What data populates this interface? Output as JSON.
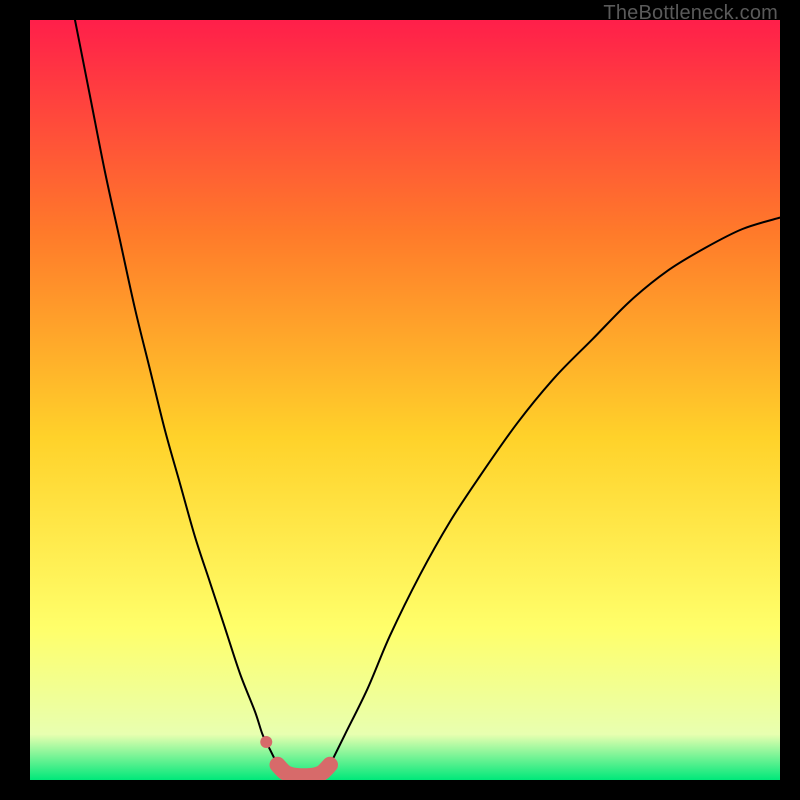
{
  "watermark": "TheBottleneck.com",
  "chart_data": {
    "type": "line",
    "title": "",
    "xlabel": "",
    "ylabel": "",
    "xlim": [
      0,
      100
    ],
    "ylim": [
      0,
      100
    ],
    "grid": false,
    "legend": false,
    "background_gradient": {
      "top": "#ff1f4a",
      "mid_upper": "#ff7a2a",
      "mid": "#ffd22a",
      "mid_lower": "#ffff6a",
      "near_bottom": "#e8ffb0",
      "bottom": "#00e87a"
    },
    "series": [
      {
        "name": "left-curve",
        "color": "#000000",
        "stroke_width": 2,
        "x": [
          6,
          8,
          10,
          12,
          14,
          16,
          18,
          20,
          22,
          24,
          26,
          28,
          30,
          31,
          32,
          33
        ],
        "y": [
          100,
          90,
          80,
          71,
          62,
          54,
          46,
          39,
          32,
          26,
          20,
          14,
          9,
          6,
          4,
          2
        ]
      },
      {
        "name": "right-curve",
        "color": "#000000",
        "stroke_width": 2,
        "x": [
          40,
          42,
          45,
          48,
          52,
          56,
          60,
          65,
          70,
          75,
          80,
          85,
          90,
          95,
          100
        ],
        "y": [
          2,
          6,
          12,
          19,
          27,
          34,
          40,
          47,
          53,
          58,
          63,
          67,
          70,
          72.5,
          74
        ]
      },
      {
        "name": "valley-marker",
        "color": "#d76a6a",
        "stroke_width": 16,
        "x": [
          33,
          34,
          35,
          36,
          37,
          38,
          39,
          40
        ],
        "y": [
          2.0,
          1.0,
          0.6,
          0.5,
          0.5,
          0.6,
          1.0,
          2.0
        ]
      }
    ],
    "points": [
      {
        "name": "marker-dot-left",
        "x": 31.5,
        "y": 5,
        "r": 6,
        "color": "#d76a6a"
      }
    ]
  }
}
